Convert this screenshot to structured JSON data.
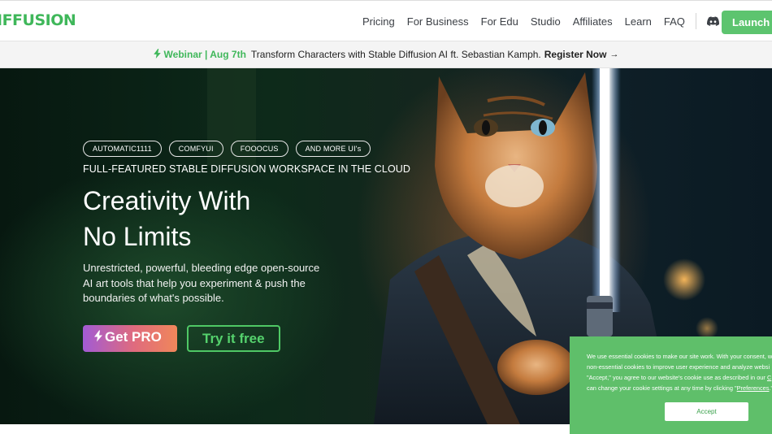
{
  "header": {
    "logo": "IFFUSION",
    "nav": [
      {
        "label": "Pricing"
      },
      {
        "label": "For Business"
      },
      {
        "label": "For Edu"
      },
      {
        "label": "Studio"
      },
      {
        "label": "Affiliates"
      },
      {
        "label": "Learn"
      },
      {
        "label": "FAQ"
      }
    ],
    "social_icons": [
      "discord-icon",
      "x-icon"
    ],
    "launch_label": "Launch A"
  },
  "banner": {
    "webinar": "Webinar | Aug 7th",
    "text": "Transform Characters with Stable Diffusion AI ft. Sebastian Kamph.",
    "register": "Register Now",
    "arrow": "→"
  },
  "hero": {
    "chips": [
      "AUTOMATIC1111",
      "COMFYUI",
      "FOOOCUS",
      "AND MORE UI's"
    ],
    "tagline": "FULL-FEATURED STABLE DIFFUSION WORKSPACE IN THE CLOUD",
    "headline_line1": "Creativity With",
    "headline_line2": "No Limits",
    "desc_line1": "Unrestricted, powerful, bleeding edge open-source",
    "desc_line2": "AI art tools that help you experiment & push the",
    "desc_line3": "boundaries of what's possible.",
    "pro_label": "Get PRO",
    "free_label": "Try it free"
  },
  "cookie": {
    "line1": "We use essential cookies to make our site work. With your consent, w",
    "line2": "non-essential cookies to improve user experience and analyze websi",
    "line3_a": "\"Accept,\" you agree to our website's cookie use as described in our ",
    "line3_link": "C",
    "line4_a": "can change your cookie settings at any time by clicking \"",
    "line4_link": "Preferences",
    "line4_b": ".\"",
    "accept_label": "Accept"
  },
  "colors": {
    "brand_green": "#3fb75a",
    "launch_green": "#5dc46f",
    "cookie_green": "#5fbf6a",
    "pro_gradient_start": "#a25bd4",
    "pro_gradient_end": "#f0875a"
  }
}
